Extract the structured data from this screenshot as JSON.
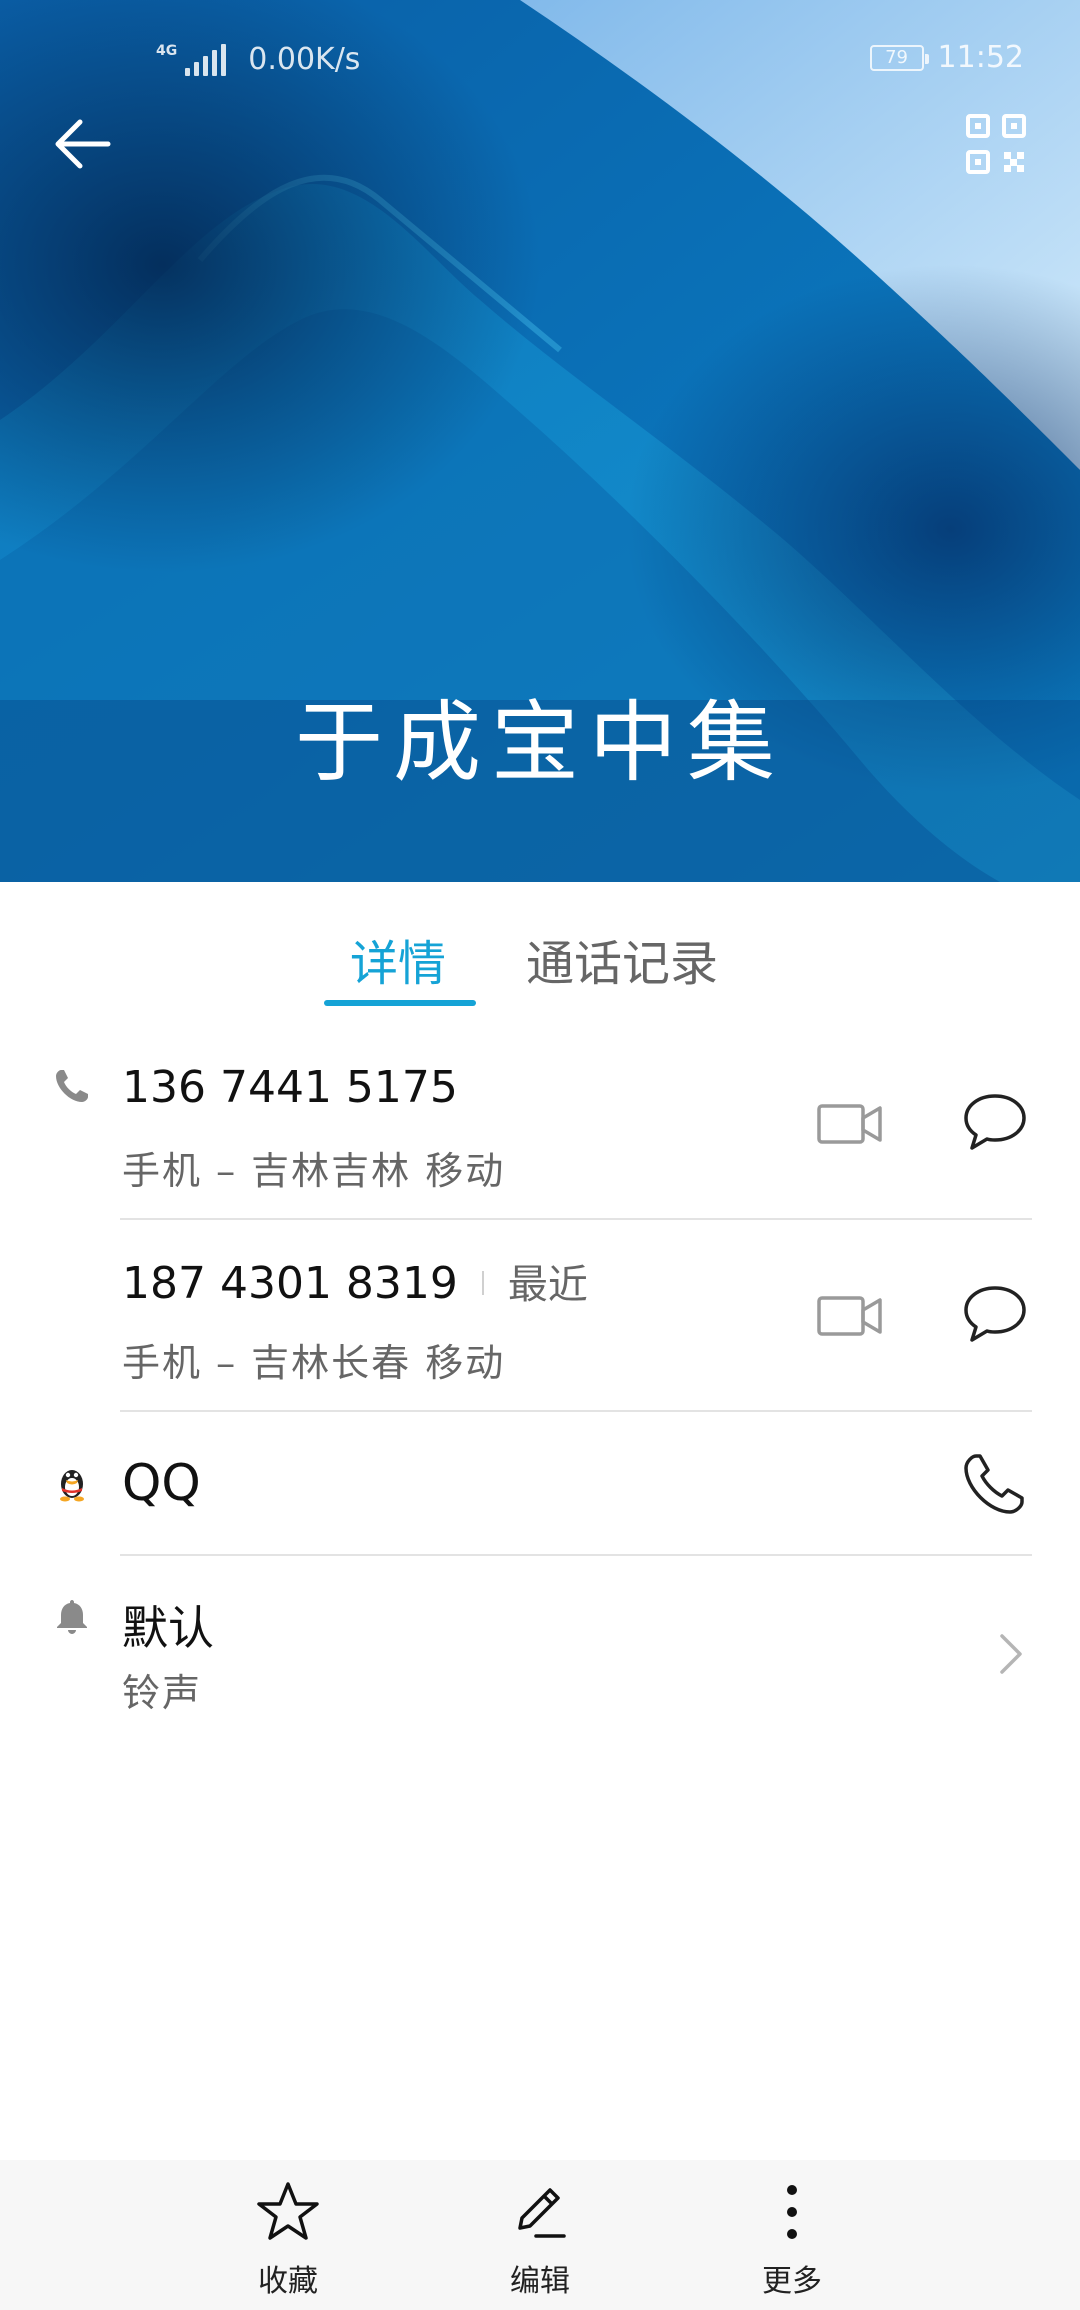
{
  "status_bar": {
    "network": "4G",
    "speed": "0.00K/s",
    "battery": "79",
    "time": "11:52"
  },
  "contact": {
    "name": "于成宝中集"
  },
  "tabs": [
    {
      "label": "详情",
      "active": true
    },
    {
      "label": "通话记录",
      "active": false
    }
  ],
  "phones": [
    {
      "number": "136 7441 5175",
      "detail": "手机 – 吉林吉林 移动",
      "recent": ""
    },
    {
      "number": "187 4301 8319",
      "detail": "手机 – 吉林长春 移动",
      "recent": "最近"
    }
  ],
  "qq": {
    "label": "QQ"
  },
  "ringtone": {
    "value": "默认",
    "label": "铃声"
  },
  "bottom_bar": {
    "favorite": "收藏",
    "edit": "编辑",
    "more": "更多"
  },
  "colors": {
    "accent": "#15a3d6",
    "hero_dark": "#063f7d",
    "hero_light": "#a9d3f3"
  }
}
